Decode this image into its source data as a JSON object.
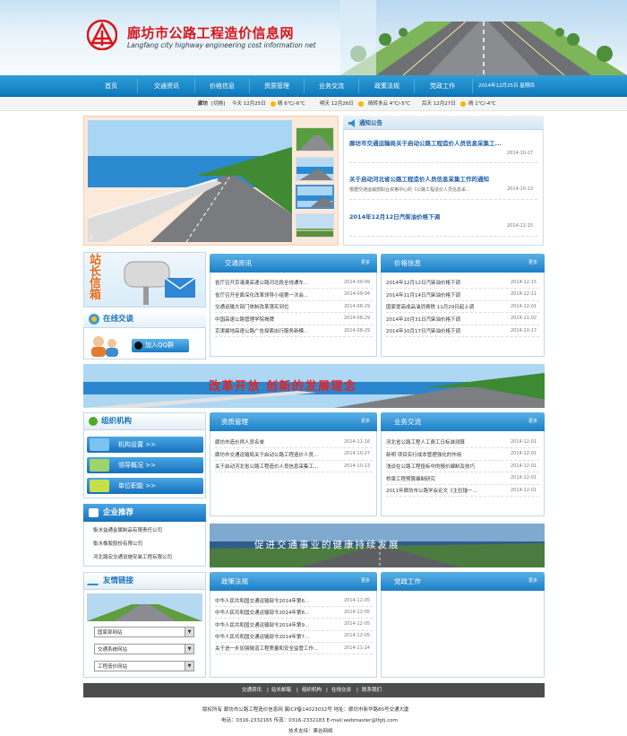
{
  "header": {
    "title": "廊坊市公路工程造价信息网",
    "subtitle": "Langfang city highway engineering cost information net"
  },
  "nav": {
    "items": [
      "首页",
      "交通资讯",
      "价格信息",
      "资质管理",
      "业务交流",
      "政策法规",
      "党政工作"
    ],
    "date": "2014年12月25日 星期四"
  },
  "weather": {
    "city": "廊坊",
    "switch": "[切换]",
    "today_label": "今天 12月25日",
    "today_temp": "晴 6℃/-6℃",
    "tomorrow_label": "明天 12月26日",
    "tomorrow_temp": "晴转多云 4℃/-5℃",
    "after_label": "后天 12月27日",
    "after_temp": "晴 1℃/-4℃"
  },
  "slider": {
    "current": "2"
  },
  "notice": {
    "title": "通知公告",
    "items": [
      {
        "title": "廊坊市交通运输局关于启动公路工程造价人员信息采集工...",
        "desc": "",
        "date": "2014-10-27"
      },
      {
        "title": "关于启动河北省公路工程造价人员信息采集工作的通知",
        "desc": "根据交通运输部职业资格中心的《公路工程造价人员信息采...",
        "date": "2014-10-13"
      },
      {
        "title": "2014年12月12日汽柴油价格下调",
        "desc": "",
        "date": "2014-12-15"
      }
    ]
  },
  "mailbox": {
    "label": "站长信箱"
  },
  "online": {
    "title": "在线交谈",
    "qq_button": "加入QQ群"
  },
  "news": {
    "title": "交通资讯",
    "more": "更多",
    "items": [
      {
        "text": "省厅召开京港澳高速公路河北段全线通车...",
        "date": "2014-09-09"
      },
      {
        "text": "省厅召开全面深化改革领导小组第一次会...",
        "date": "2014-09-04"
      },
      {
        "text": "交通运输大部门体制改革落实到位",
        "date": "2014-08-29"
      },
      {
        "text": "中国高速公路管理学院揭牌",
        "date": "2014-08-29"
      },
      {
        "text": "京津冀地高速公路广告探索出行服务新模...",
        "date": "2014-08-29"
      }
    ]
  },
  "price": {
    "title": "价格信息",
    "more": "更多",
    "items": [
      {
        "text": "2014年12月12日汽柴油价格下调",
        "date": "2014-12-15"
      },
      {
        "text": "2014年11月14日汽柴油价格下调",
        "date": "2014-12-11"
      },
      {
        "text": "国家提高成品油消费税 11月29日起上调",
        "date": "2014-12-01"
      },
      {
        "text": "2014年10月31日汽柴油价格下调",
        "date": "2014-11-02"
      },
      {
        "text": "2014年10月17日汽柴油价格下调",
        "date": "2014-10-17"
      }
    ]
  },
  "banner1": {
    "text": "改革开放   创新的发展理念"
  },
  "org": {
    "title": "组织机构",
    "buttons": [
      "机构设置 >>",
      "领导概况 >>",
      "单位职能 >>"
    ]
  },
  "recommend": {
    "title": "企业推荐",
    "items": [
      "衡水益通金属制品有限责任公司",
      "衡水橡胶股份有限公司",
      "河北路宏交通设施安装工程有限公司"
    ]
  },
  "qualification": {
    "title": "资质管理",
    "more": "更多",
    "items": [
      {
        "text": "廊坊市造价师人员名单",
        "date": "2014-11-16"
      },
      {
        "text": "廊坊市交通运输局关于启动公路工程造价人员...",
        "date": "2014-10-27"
      },
      {
        "text": "关于启动河北省公路工程造价人员信息采集工...",
        "date": "2014-10-13"
      }
    ]
  },
  "exchange": {
    "title": "业务交流",
    "more": "更多",
    "items": [
      {
        "text": "河北省公路工程人工费工日标准测算",
        "date": "2014-12-01"
      },
      {
        "text": "新明 项目实行成本管理强化的作用",
        "date": "2014-12-01"
      },
      {
        "text": "浅谈在公路工程投标中的报价编制及技巧",
        "date": "2014-12-01"
      },
      {
        "text": "桥梁工程预算编制研究",
        "date": "2014-12-01"
      },
      {
        "text": "2011年廊坊市公路学会论文《主拉锚一...",
        "date": "2014-12-01"
      }
    ]
  },
  "banner2": {
    "text": "促进交通事业的健康持续发展"
  },
  "links": {
    "title": "友情链接",
    "selects": [
      "国家部网站",
      "交通系统网站",
      "工程造价网站"
    ]
  },
  "policy": {
    "title": "政策法规",
    "more": "更多",
    "items": [
      {
        "text": "中华人民共和国交通运输部令2014年第6...",
        "date": "2014-12-05"
      },
      {
        "text": "中华人民共和国交通运输部令2014年第8...",
        "date": "2014-12-05"
      },
      {
        "text": "中华人民共和国交通运输部令2014年第9...",
        "date": "2014-12-05"
      },
      {
        "text": "中华人民共和国交通运输部令2014年第7...",
        "date": "2014-12-05"
      },
      {
        "text": "关于进一步加强隧道工程质量和安全监管工作...",
        "date": "2014-11-24"
      }
    ]
  },
  "party": {
    "title": "党政工作",
    "more": "更多"
  },
  "footer": {
    "links": [
      "交通资讯",
      "站长邮箱",
      "组织机构",
      "在线交谈",
      "联系我们"
    ],
    "line1": "版权所有  廊坊市公路工程造价信息网 冀ICP备14023032号  地址：廊坊市新华路80号交通大厦",
    "line2": "电话：0316-2332165 传真：0316-2332183 E-mail:webmaster@lfgtj.com",
    "line3": "技术支持：果谷网络"
  },
  "colors": {
    "nav": "#1a84c7",
    "title": "#d8161b",
    "link": "#1d5fa9"
  }
}
